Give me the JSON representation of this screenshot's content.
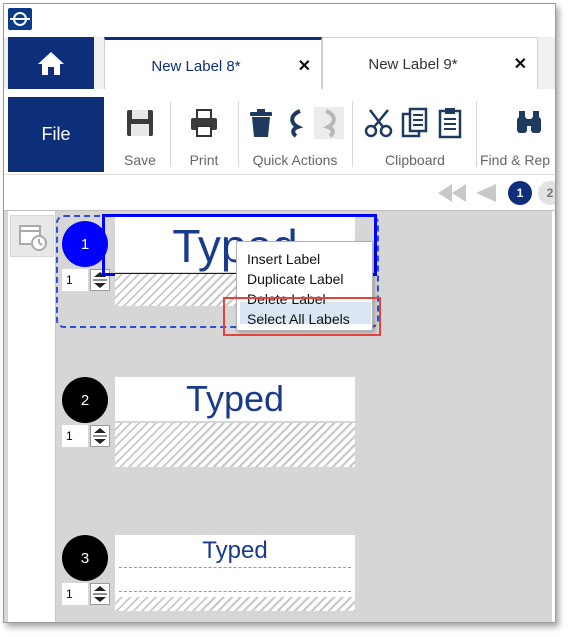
{
  "tabs": [
    {
      "label": "New Label 8*",
      "active": true
    },
    {
      "label": "New Label 9*",
      "active": false
    }
  ],
  "ribbon": {
    "file_label": "File",
    "save_label": "Save",
    "print_label": "Print",
    "quick_actions_label": "Quick Actions",
    "clipboard_label": "Clipboard",
    "find_replace_label": "Find & Rep"
  },
  "pager": {
    "pages": [
      "1",
      "2"
    ],
    "current": "1"
  },
  "labels": [
    {
      "number": "1",
      "quantity": "1",
      "text": "Typed"
    },
    {
      "number": "2",
      "quantity": "1",
      "text": "Typed"
    },
    {
      "number": "3",
      "quantity": "1",
      "text": "Typed"
    }
  ],
  "context_menu": {
    "items": [
      "Insert Label",
      "Duplicate Label",
      "Delete Label",
      "Select All Labels"
    ],
    "highlighted": "Select All Labels"
  },
  "colors": {
    "brand": "#0d2f7a",
    "selected_label": "#0000ff",
    "label_text": "#1a3a8c",
    "callout": "#e0443a"
  },
  "icons": {
    "app": "app-logo-icon",
    "home": "home-icon",
    "save": "save-icon",
    "print": "print-icon",
    "delete": "trash-icon",
    "undo": "undo-icon",
    "redo": "redo-icon",
    "cut": "scissors-icon",
    "copy": "copy-icon",
    "paste": "paste-icon",
    "find": "binoculars-icon",
    "calendar": "calendar-clock-icon"
  }
}
